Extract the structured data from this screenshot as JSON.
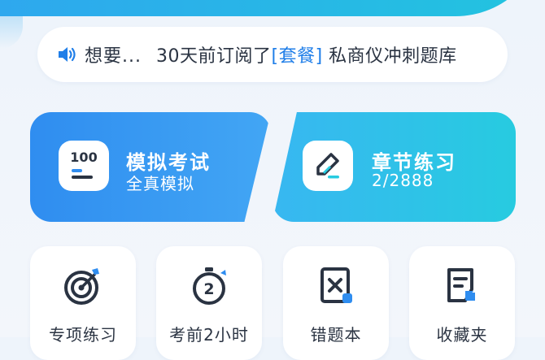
{
  "notice": {
    "user": "想要...",
    "message_prefix": "30天前订阅了",
    "message_highlight": "[套餐]",
    "message_suffix": " 私商仪冲刺题库"
  },
  "cards": {
    "mock": {
      "icon_text": "100",
      "title": "模拟考试",
      "subtitle": "全真模拟"
    },
    "chapter": {
      "title": "章节练习",
      "progress": "2/2888"
    }
  },
  "tiles": [
    {
      "label": "专项练习"
    },
    {
      "label": "考前2小时",
      "icon_text": "2"
    },
    {
      "label": "错题本"
    },
    {
      "label": "收藏夹"
    }
  ],
  "colors": {
    "accent": "#1f7ee8",
    "mock_card": "#2f8df0",
    "chapter_card": "#27cbe0",
    "text": "#2a3342"
  }
}
